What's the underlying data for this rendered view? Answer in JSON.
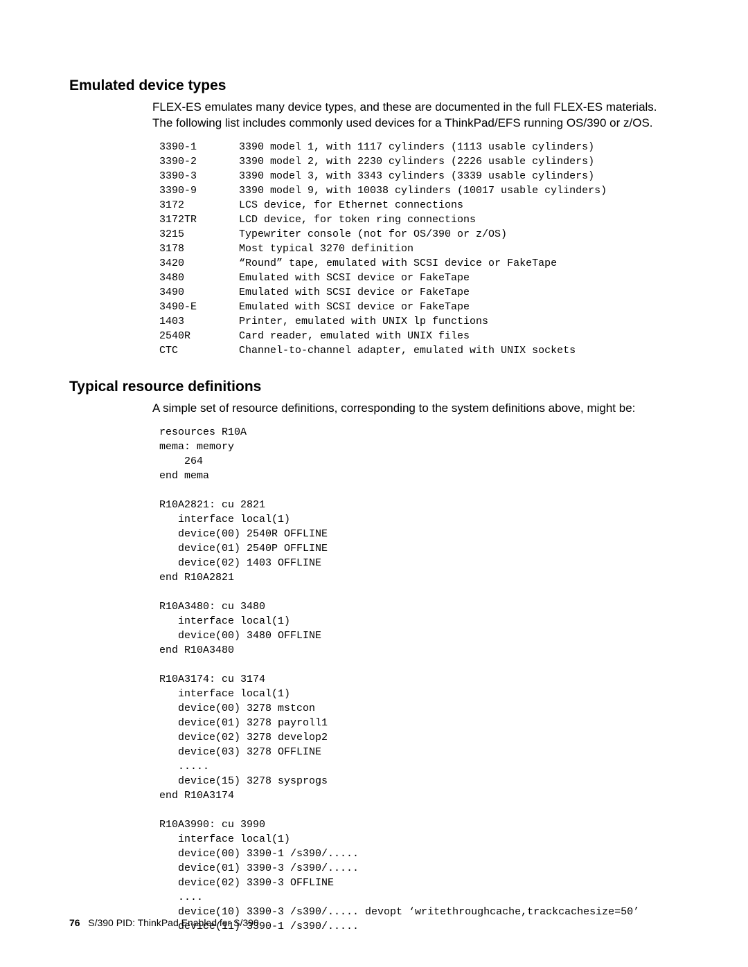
{
  "section1": {
    "heading": "Emulated device types",
    "para": "FLEX-ES emulates many device types, and these are documented in the full FLEX-ES materials.  The following list includes commonly used devices for a ThinkPad/EFS running OS/390 or z/OS.",
    "devices": [
      {
        "k": "3390-1",
        "d": "3390 model 1, with 1117 cylinders (1113 usable cylinders)"
      },
      {
        "k": "3390-2",
        "d": "3390 model 2, with 2230 cylinders (2226 usable cylinders)"
      },
      {
        "k": "3390-3",
        "d": "3390 model 3, with 3343 cylinders (3339 usable cylinders)"
      },
      {
        "k": "3390-9",
        "d": "3390 model 9, with 10038 cylinders (10017 usable cylinders)"
      },
      {
        "k": "3172",
        "d": "LCS device, for Ethernet connections"
      },
      {
        "k": "3172TR",
        "d": "LCD device, for token ring connections"
      },
      {
        "k": "3215",
        "d": "Typewriter console (not for OS/390 or z/OS)"
      },
      {
        "k": "3178",
        "d": "Most typical 3270 definition"
      },
      {
        "k": "3420",
        "d": "“Round” tape, emulated with SCSI device or FakeTape"
      },
      {
        "k": "3480",
        "d": "Emulated with SCSI device or FakeTape"
      },
      {
        "k": "3490",
        "d": "Emulated with SCSI device or FakeTape"
      },
      {
        "k": "3490-E",
        "d": "Emulated with SCSI device or FakeTape"
      },
      {
        "k": "1403",
        "d": "Printer, emulated with UNIX lp functions"
      },
      {
        "k": "2540R",
        "d": "Card reader, emulated with UNIX files"
      },
      {
        "k": "CTC",
        "d": "Channel-to-channel adapter, emulated with UNIX sockets"
      }
    ]
  },
  "section2": {
    "heading": "Typical resource definitions",
    "para": "A simple set of resource definitions, corresponding to the system definitions above, might be:",
    "code": "resources R10A\nmema: memory\n    264\nend mema\n\nR10A2821: cu 2821\n   interface local(1)\n   device(00) 2540R OFFLINE\n   device(01) 2540P OFFLINE\n   device(02) 1403 OFFLINE\nend R10A2821\n\nR10A3480: cu 3480\n   interface local(1)\n   device(00) 3480 OFFLINE\nend R10A3480\n\nR10A3174: cu 3174\n   interface local(1)\n   device(00) 3278 mstcon\n   device(01) 3278 payroll1\n   device(02) 3278 develop2\n   device(03) 3278 OFFLINE\n   .....\n   device(15) 3278 sysprogs\nend R10A3174\n\nR10A3990: cu 3990\n   interface local(1)\n   device(00) 3390-1 /s390/.....\n   device(01) 3390-3 /s390/.....\n   device(02) 3390-3 OFFLINE\n   ....\n   device(10) 3390-3 /s390/..... devopt ‘writethroughcache,trackcachesize=50’\n   device(11) 3390-1 /s390/....."
  },
  "footer": {
    "pagenum": "76",
    "title": "S/390 PID: ThinkPad Enabled for S/390"
  }
}
